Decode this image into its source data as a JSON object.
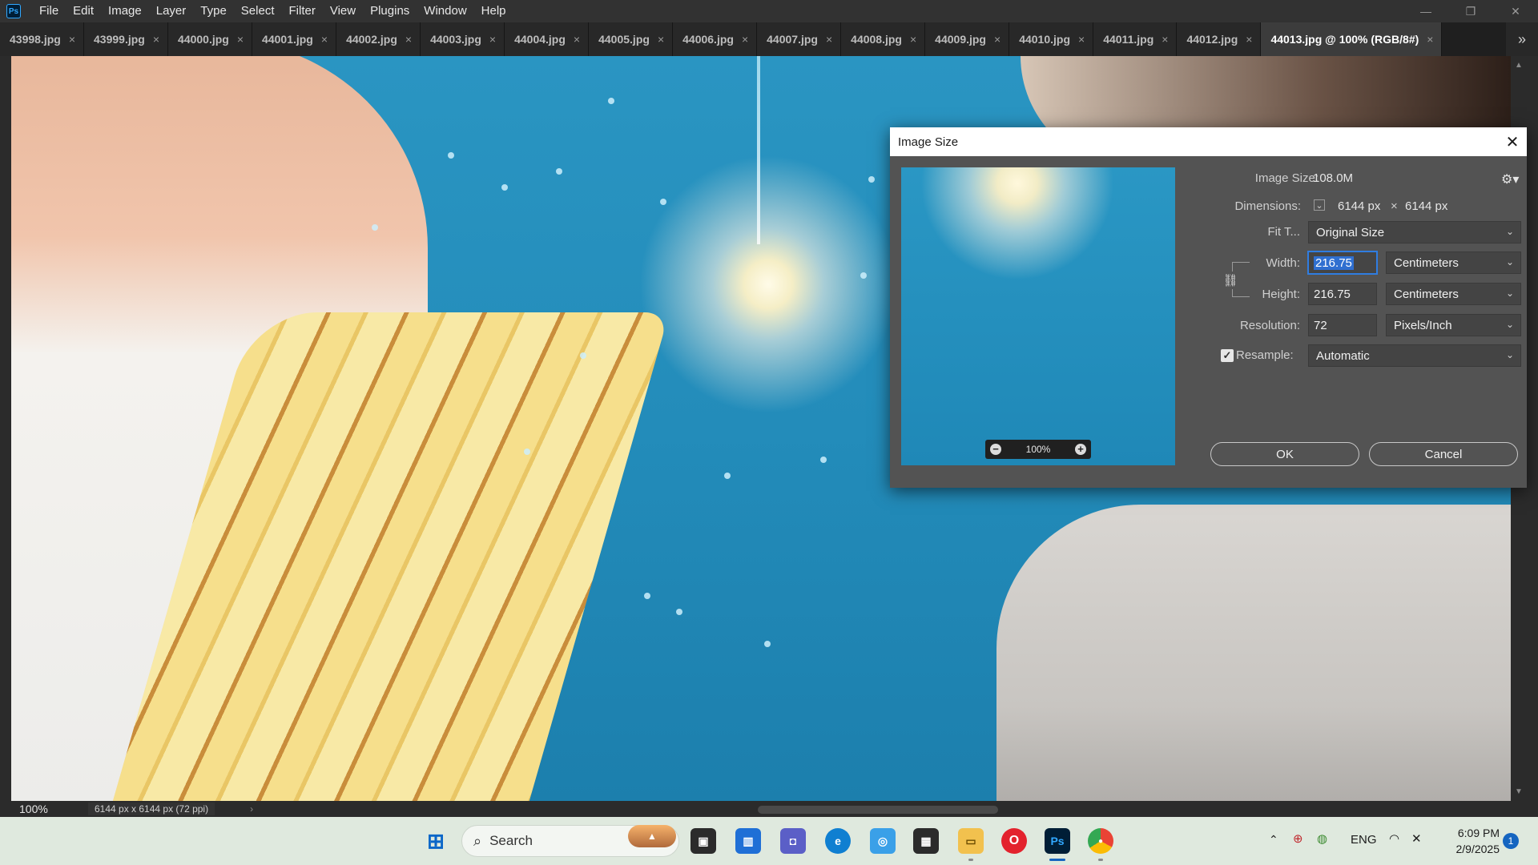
{
  "app": {
    "logo": "Ps"
  },
  "menu": [
    "File",
    "Edit",
    "Image",
    "Layer",
    "Type",
    "Select",
    "Filter",
    "View",
    "Plugins",
    "Window",
    "Help"
  ],
  "window_controls": {
    "minimize": "—",
    "restore": "❐",
    "close": "✕"
  },
  "tabs": [
    {
      "label": "43998.jpg",
      "active": false
    },
    {
      "label": "43999.jpg",
      "active": false
    },
    {
      "label": "44000.jpg",
      "active": false
    },
    {
      "label": "44001.jpg",
      "active": false
    },
    {
      "label": "44002.jpg",
      "active": false
    },
    {
      "label": "44003.jpg",
      "active": false
    },
    {
      "label": "44004.jpg",
      "active": false
    },
    {
      "label": "44005.jpg",
      "active": false
    },
    {
      "label": "44006.jpg",
      "active": false
    },
    {
      "label": "44007.jpg",
      "active": false
    },
    {
      "label": "44008.jpg",
      "active": false
    },
    {
      "label": "44009.jpg",
      "active": false
    },
    {
      "label": "44010.jpg",
      "active": false
    },
    {
      "label": "44011.jpg",
      "active": false
    },
    {
      "label": "44012.jpg",
      "active": false
    },
    {
      "label": "44013.jpg @ 100% (RGB/8#)",
      "active": true
    }
  ],
  "tab_close_glyph": "×",
  "tab_overflow": "»",
  "status": {
    "zoom": "100%",
    "doc_info": "6144 px x 6144 px (72 ppi)",
    "arrow": "›"
  },
  "dialog": {
    "title": "Image Size",
    "close": "✕",
    "image_size_label": "Image Size:",
    "image_size_value": "108.0M",
    "dimensions_label": "Dimensions:",
    "dim_width": "6144 px",
    "dim_times": "×",
    "dim_height": "6144 px",
    "fit_to_label": "Fit T...",
    "fit_to_value": "Original Size",
    "width_label": "Width:",
    "width_value": "216.75",
    "width_unit": "Centimeters",
    "height_label": "Height:",
    "height_value": "216.75",
    "height_unit": "Centimeters",
    "resolution_label": "Resolution:",
    "resolution_value": "72",
    "resolution_unit": "Pixels/Inch",
    "resample_label": "Resample:",
    "resample_checked": true,
    "resample_value": "Automatic",
    "preview_zoom": "100%",
    "ok_label": "OK",
    "cancel_label": "Cancel",
    "gear_icon": "gear-icon",
    "link_icon": "chain-link-icon"
  },
  "taskbar": {
    "search_placeholder": "Search",
    "lang": "ENG",
    "time": "6:09 PM",
    "date": "2/9/2025",
    "notification_count": "1"
  },
  "colors": {
    "ps_blue": "#31a8ff",
    "accent": "#2f7de1",
    "taskbar_bg": "#dfe9de"
  }
}
